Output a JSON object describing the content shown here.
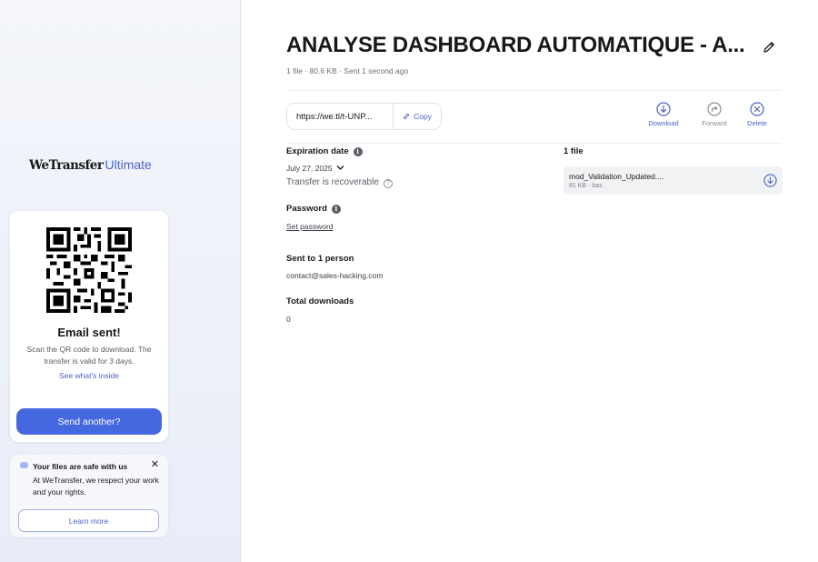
{
  "sidebar": {
    "brand": "WeTransfer",
    "tier": "Ultimate",
    "card": {
      "title": "Email sent!",
      "text": "Scan the QR code to download. The transfer is valid for 3 days.",
      "link": "See what's inside",
      "send_button": "Send another?"
    },
    "notice": {
      "title": "Your files are safe with us",
      "text": "At WeTransfer, we respect your work and your rights.",
      "close_icon": "close-icon",
      "learn_button": "Learn more"
    }
  },
  "transfer": {
    "title": "ANALYSE DASHBOARD AUTOMATIQUE - A...",
    "meta": "1 file · 80.6 KB · Sent 1 second ago",
    "link_url": "https://we.tl/t-UNP...",
    "copy_label": "Copy",
    "actions": {
      "download": "Download",
      "forward": "Forward",
      "delete": "Delete"
    },
    "expiration": {
      "label": "Expiration date",
      "date": "July 27, 2025",
      "recoverable": "Transfer is recoverable"
    },
    "password": {
      "label": "Password",
      "action": "Set password"
    },
    "recipients": {
      "label": "Sent to 1 person",
      "email": "contact@sales-hacking.com"
    },
    "downloads": {
      "label": "Total downloads",
      "count": "0"
    },
    "files": {
      "label": "1 file",
      "items": [
        {
          "name": "mod_Validation_Updated....",
          "meta": "81 KB · bas"
        }
      ]
    }
  },
  "colors": {
    "accent": "#4568e0",
    "link": "#4a63c9",
    "sidebar_bg": "#eef1f9"
  }
}
